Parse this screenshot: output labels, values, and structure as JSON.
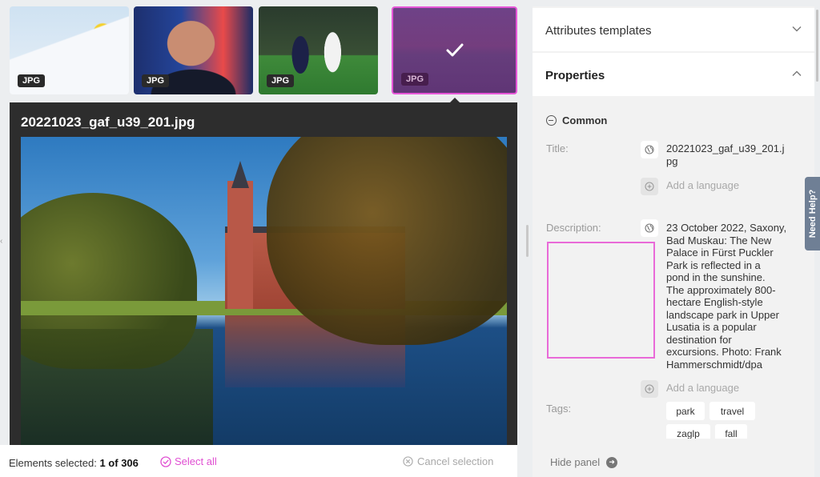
{
  "thumbnails": [
    {
      "format": "JPG",
      "selected": false
    },
    {
      "format": "JPG",
      "selected": false
    },
    {
      "format": "JPG",
      "selected": false
    },
    {
      "format": "JPG",
      "selected": true
    }
  ],
  "preview": {
    "filename": "20221023_gaf_u39_201.jpg"
  },
  "bottom_bar": {
    "elements_selected_label": "Elements selected:",
    "elements_selected_value": "1 of 306",
    "select_all": "Select all",
    "cancel_selection": "Cancel selection"
  },
  "panel": {
    "attributes_templates": "Attributes templates",
    "properties": "Properties",
    "common": "Common",
    "title_label": "Title:",
    "title_value_line1": "20221023_gaf_u39_201.j",
    "title_value_line2": "pg",
    "add_language": "Add a language",
    "description_label": "Description:",
    "description_lines": [
      "23 October 2022, Saxony,",
      "Bad Muskau: The New",
      "Palace in Fürst Puckler",
      "Park is reflected in a",
      "pond in the sunshine.",
      "The approximately 800-",
      "hectare English-style",
      "landscape park in Upper",
      "Lusatia is a popular",
      "destination for",
      "excursions. Photo: Frank",
      "Hammerschmidt/dpa"
    ],
    "tags_label": "Tags:",
    "tags": [
      "park",
      "travel",
      "zaglp",
      "fall"
    ],
    "hide_panel": "Hide panel"
  },
  "need_help": "Need Help?",
  "colors": {
    "accent": "#e04fd2",
    "selection_border": "#e657d8",
    "help_tab": "#6f7f95"
  }
}
